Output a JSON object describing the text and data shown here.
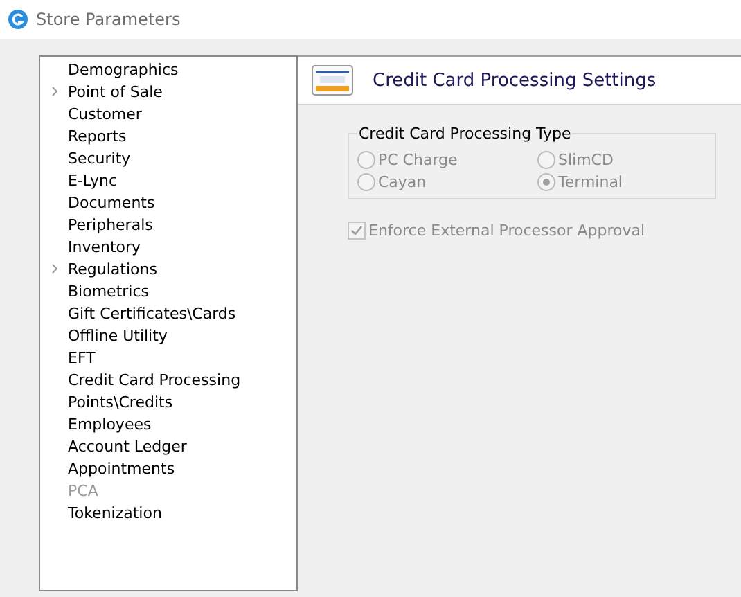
{
  "window": {
    "title": "Store Parameters"
  },
  "tree": [
    {
      "label": "Demographics",
      "expandable": false,
      "disabled": false
    },
    {
      "label": "Point of Sale",
      "expandable": true,
      "disabled": false
    },
    {
      "label": "Customer",
      "expandable": false,
      "disabled": false
    },
    {
      "label": "Reports",
      "expandable": false,
      "disabled": false
    },
    {
      "label": "Security",
      "expandable": false,
      "disabled": false
    },
    {
      "label": "E-Lync",
      "expandable": false,
      "disabled": false
    },
    {
      "label": "Documents",
      "expandable": false,
      "disabled": false
    },
    {
      "label": "Peripherals",
      "expandable": false,
      "disabled": false
    },
    {
      "label": "Inventory",
      "expandable": false,
      "disabled": false
    },
    {
      "label": "Regulations",
      "expandable": true,
      "disabled": false
    },
    {
      "label": "Biometrics",
      "expandable": false,
      "disabled": false
    },
    {
      "label": "Gift Certificates\\Cards",
      "expandable": false,
      "disabled": false
    },
    {
      "label": "Offline Utility",
      "expandable": false,
      "disabled": false
    },
    {
      "label": "EFT",
      "expandable": false,
      "disabled": false
    },
    {
      "label": "Credit Card Processing",
      "expandable": false,
      "disabled": false
    },
    {
      "label": "Points\\Credits",
      "expandable": false,
      "disabled": false
    },
    {
      "label": "Employees",
      "expandable": false,
      "disabled": false
    },
    {
      "label": "Account Ledger",
      "expandable": false,
      "disabled": false
    },
    {
      "label": "Appointments",
      "expandable": false,
      "disabled": false
    },
    {
      "label": "PCA",
      "expandable": false,
      "disabled": true
    },
    {
      "label": "Tokenization",
      "expandable": false,
      "disabled": false
    }
  ],
  "panel": {
    "title": "Credit Card Processing Settings",
    "group": {
      "title": "Credit Card Processing Type",
      "options": [
        {
          "label": "PC Charge",
          "selected": false,
          "disabled": true
        },
        {
          "label": "SlimCD",
          "selected": false,
          "disabled": true
        },
        {
          "label": "Cayan",
          "selected": false,
          "disabled": true
        },
        {
          "label": "Terminal",
          "selected": true,
          "disabled": true
        }
      ]
    },
    "checkbox": {
      "label": "Enforce External Processor Approval",
      "checked": true,
      "disabled": true
    }
  }
}
